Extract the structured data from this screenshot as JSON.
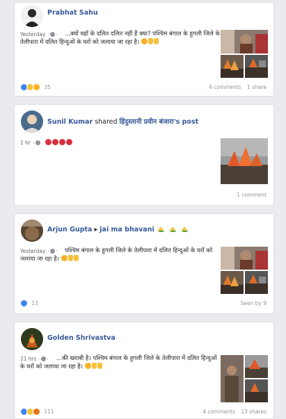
{
  "posts": [
    {
      "author": "Prabhat Sahu",
      "time": "Yesterday",
      "text": "...क्यों वहाँ के दलित दलित नहीं हैं क्या? पश्चिम बंगाल के हुगली जिले के तेलीपारा में दलित हिन्दुओं के घरों को जलाया जा रहा है।",
      "reaction_count": "35",
      "comments": "4 comments",
      "shares": "1 share"
    },
    {
      "author": "Sunil Kumar",
      "shared_text": "shared",
      "shared_page": "हिंदुस्तानी प्रवीन बंजारा's post",
      "time": "1 hr",
      "comments": "1 comment"
    },
    {
      "author": "Arjun Gupta",
      "feeling": "jai ma bhavani",
      "time": "Yesterday",
      "text": "पश्चिम बंगाल के हुगली जिले के तेलीपारा में दलित हिन्दुओं के घरों को जलाया जा रहा है।",
      "reaction_count": "13",
      "seen_by": "Seen by 9"
    },
    {
      "author": "Golden Shrivastva",
      "time": "21 hrs",
      "text": "...की खराबी है। पश्चिम बंगाल के हुगली जिले के तेलीपारा में दलित हिन्दुओं के घरों को जलाया जा रहा है।",
      "reaction_count": "111",
      "comments": "4 comments",
      "shares": "13 shares"
    }
  ],
  "colors": {
    "background": "#e9ebee",
    "link_blue": "#365899",
    "meta_gray": "#90949c",
    "like_blue": "#3f84f2"
  }
}
